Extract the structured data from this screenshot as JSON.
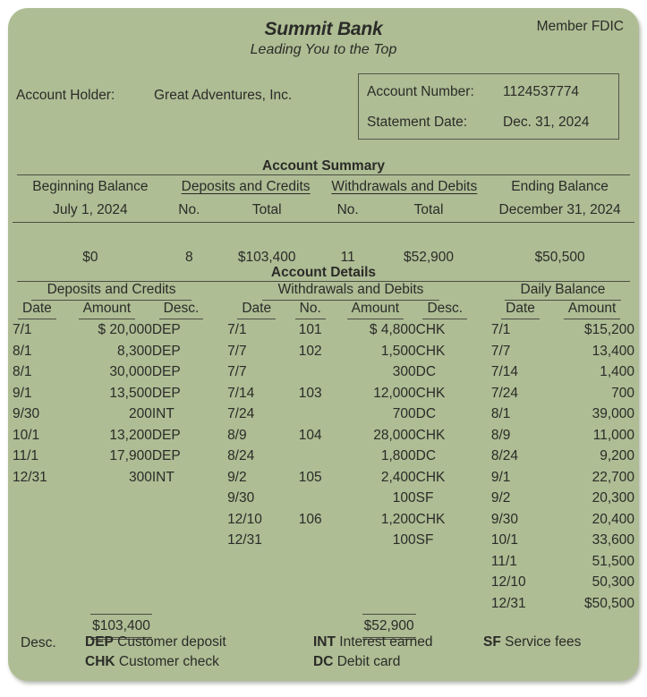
{
  "colors": {
    "background": "#aebd94",
    "text": "#2b2b28",
    "rule": "#4b4d43"
  },
  "header": {
    "bank_name": "Summit Bank",
    "tagline": "Leading You to the Top",
    "member_fdic": "Member FDIC",
    "account_holder_label": "Account Holder:",
    "account_holder_value": "Great Adventures, Inc.",
    "account_number_label": "Account Number:",
    "account_number_value": "1124537774",
    "statement_date_label": "Statement Date:",
    "statement_date_value": "Dec. 31, 2024"
  },
  "summary": {
    "title": "Account Summary",
    "group_headers": {
      "beginning_balance": "Beginning Balance",
      "deposits_and_credits": "Deposits and Credits",
      "withdrawals_and_debits": "Withdrawals and Debits",
      "ending_balance": "Ending Balance"
    },
    "sub_headers": {
      "beginning_date": "July 1, 2024",
      "deposits_no": "No.",
      "deposits_total": "Total",
      "withdrawals_no": "No.",
      "withdrawals_total": "Total",
      "ending_date": "December 31, 2024"
    },
    "values": {
      "beginning_balance": "$0",
      "deposits_no": "8",
      "deposits_total": "$103,400",
      "withdrawals_no": "11",
      "withdrawals_total": "$52,900",
      "ending_balance": "$50,500"
    }
  },
  "details": {
    "title": "Account Details",
    "groups": {
      "deposits": "Deposits and Credits",
      "withdrawals": "Withdrawals and Debits",
      "daily_balance": "Daily Balance"
    },
    "columns": {
      "dep_date": "Date",
      "dep_amount": "Amount",
      "dep_desc": "Desc.",
      "wd_date": "Date",
      "wd_no": "No.",
      "wd_amount": "Amount",
      "wd_desc": "Desc.",
      "bal_date": "Date",
      "bal_amount": "Amount"
    },
    "deposits_rows": [
      {
        "date": "7/1",
        "amount": "$ 20,000",
        "desc": "DEP"
      },
      {
        "date": "8/1",
        "amount": "8,300",
        "desc": "DEP"
      },
      {
        "date": "8/1",
        "amount": "30,000",
        "desc": "DEP"
      },
      {
        "date": "9/1",
        "amount": "13,500",
        "desc": "DEP"
      },
      {
        "date": "9/30",
        "amount": "200",
        "desc": "INT"
      },
      {
        "date": "10/1",
        "amount": "13,200",
        "desc": "DEP"
      },
      {
        "date": "11/1",
        "amount": "17,900",
        "desc": "DEP"
      },
      {
        "date": "12/31",
        "amount": "300",
        "desc": "INT"
      }
    ],
    "deposits_total": "$103,400",
    "withdrawals_rows": [
      {
        "date": "7/1",
        "no": "101",
        "amount": "$  4,800",
        "desc": "CHK"
      },
      {
        "date": "7/7",
        "no": "102",
        "amount": "1,500",
        "desc": "CHK"
      },
      {
        "date": "7/7",
        "no": "",
        "amount": "300",
        "desc": "DC"
      },
      {
        "date": "7/14",
        "no": "103",
        "amount": "12,000",
        "desc": "CHK"
      },
      {
        "date": "7/24",
        "no": "",
        "amount": "700",
        "desc": "DC"
      },
      {
        "date": "8/9",
        "no": "104",
        "amount": "28,000",
        "desc": "CHK"
      },
      {
        "date": "8/24",
        "no": "",
        "amount": "1,800",
        "desc": "DC"
      },
      {
        "date": "9/2",
        "no": "105",
        "amount": "2,400",
        "desc": "CHK"
      },
      {
        "date": "9/30",
        "no": "",
        "amount": "100",
        "desc": "SF"
      },
      {
        "date": "12/10",
        "no": "106",
        "amount": "1,200",
        "desc": "CHK"
      },
      {
        "date": "12/31",
        "no": "",
        "amount": "100",
        "desc": "SF"
      }
    ],
    "withdrawals_total": "$52,900",
    "balance_rows": [
      {
        "date": "7/1",
        "amount": "$15,200"
      },
      {
        "date": "7/7",
        "amount": "13,400"
      },
      {
        "date": "7/14",
        "amount": "1,400"
      },
      {
        "date": "7/24",
        "amount": "700"
      },
      {
        "date": "8/1",
        "amount": "39,000"
      },
      {
        "date": "8/9",
        "amount": "11,000"
      },
      {
        "date": "8/24",
        "amount": "9,200"
      },
      {
        "date": "9/1",
        "amount": "22,700"
      },
      {
        "date": "9/2",
        "amount": "20,300"
      },
      {
        "date": "9/30",
        "amount": "20,400"
      },
      {
        "date": "10/1",
        "amount": "33,600"
      },
      {
        "date": "11/1",
        "amount": "51,500"
      },
      {
        "date": "12/10",
        "amount": "50,300"
      },
      {
        "date": "12/31",
        "amount": "$50,500"
      }
    ]
  },
  "legend": {
    "label": "Desc.",
    "entries": [
      {
        "code": "DEP",
        "text": "Customer deposit",
        "col": 1,
        "row": 1
      },
      {
        "code": "CHK",
        "text": "Customer check",
        "col": 1,
        "row": 2
      },
      {
        "code": "INT",
        "text": "Interest earned",
        "col": 2,
        "row": 1
      },
      {
        "code": "DC",
        "text": "Debit card",
        "col": 2,
        "row": 2
      },
      {
        "code": "SF",
        "text": "Service fees",
        "col": 3,
        "row": 1
      }
    ]
  }
}
